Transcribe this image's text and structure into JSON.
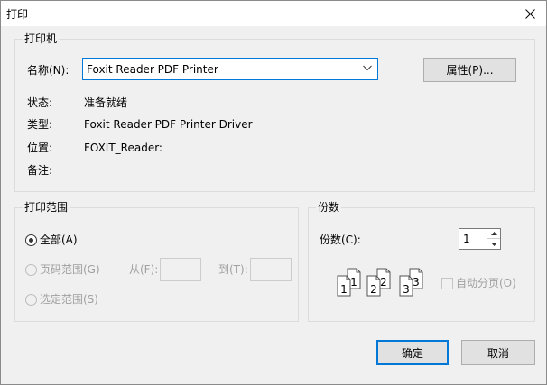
{
  "window": {
    "title": "打印",
    "close_icon": "close-icon"
  },
  "printer": {
    "group_label": "打印机",
    "name_label": "名称(N):",
    "selected_printer": "Foxit Reader PDF Printer",
    "properties_label": "属性(P)...",
    "status_label": "状态:",
    "status_value": "准备就绪",
    "type_label": "类型:",
    "type_value": "Foxit Reader PDF Printer Driver",
    "location_label": "位置:",
    "location_value": "FOXIT_Reader:",
    "comment_label": "备注:",
    "comment_value": ""
  },
  "print_range": {
    "group_label": "打印范围",
    "all_label": "全部(A)",
    "all_checked": true,
    "pages_label": "页码范围(G)",
    "from_label": "从(F):",
    "from_value": "",
    "to_label": "到(T):",
    "to_value": "",
    "selection_label": "选定范围(S)"
  },
  "copies": {
    "group_label": "份数",
    "count_label": "份数(C):",
    "count_value": "1",
    "collate_label": "自动分页(O)",
    "collate_checked": false,
    "collate_pages": [
      "1",
      "1",
      "2",
      "2",
      "3",
      "3"
    ]
  },
  "actions": {
    "ok_label": "确定",
    "cancel_label": "取消"
  },
  "colors": {
    "accent": "#0078d7",
    "background": "#f0f0f0",
    "disabled_text": "#a0a0a0"
  }
}
